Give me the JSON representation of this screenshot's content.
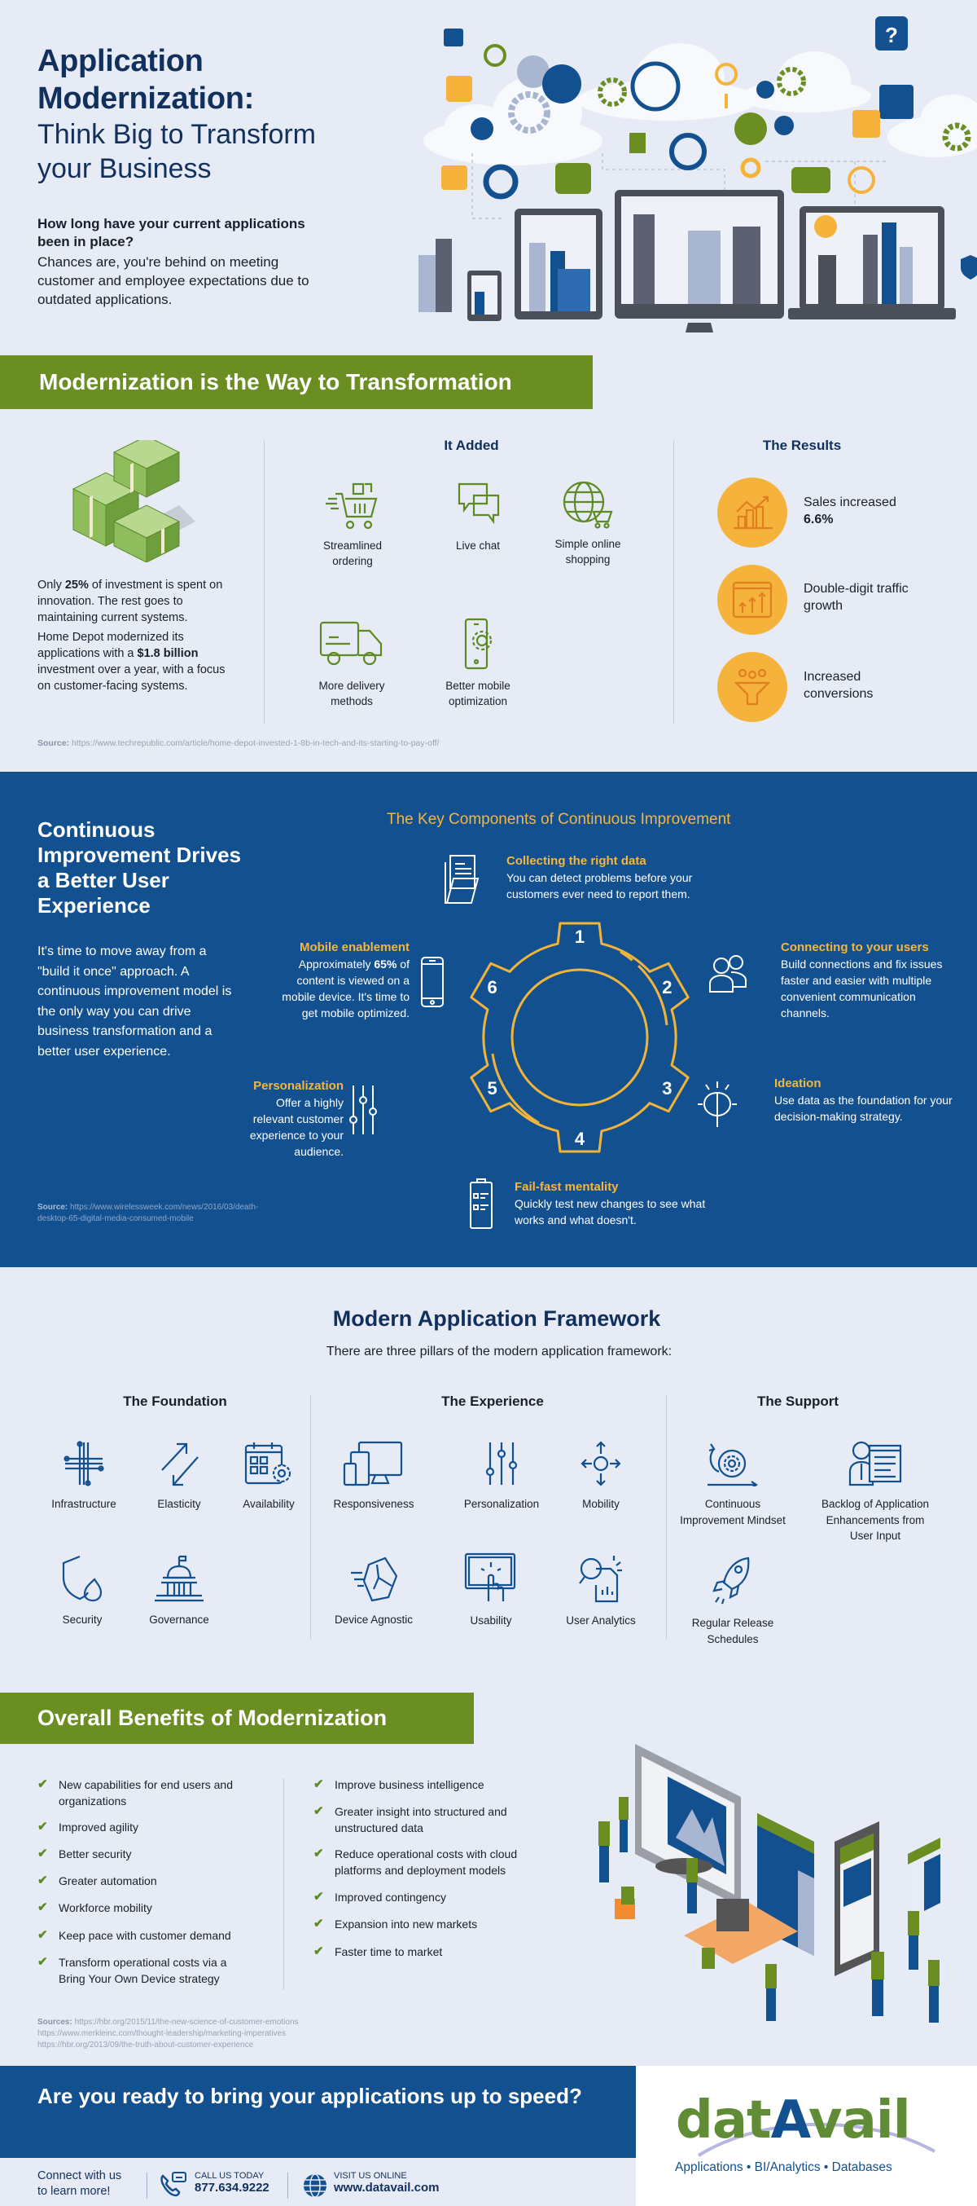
{
  "hero": {
    "title_bold": "Application Modernization:",
    "title_line1": "Application",
    "title_line2": "Modernization:",
    "subtitle_line1": "Think Big to Transform",
    "subtitle_line2": "your Business",
    "question": "How long have your current applications been in place?",
    "body": "Chances are, you're behind on meeting customer and employee expectations due to outdated applications."
  },
  "section1": {
    "banner": "Modernization is the Way to Transformation",
    "stat1_pre": "Only ",
    "stat1_bold": "25%",
    "stat1_post": " of investment is spent on innovation. The rest goes to maintaining current systems.",
    "stat2_pre": "Home Depot modernized its applications with a ",
    "stat2_bold": "$1.8 billion",
    "stat2_post": " investment over a year, with a focus on customer-facing systems.",
    "added_heading": "It Added",
    "added_items": [
      {
        "label": "Streamlined ordering",
        "icon": "shopping-cart-icon"
      },
      {
        "label": "Live chat",
        "icon": "chat-bubbles-icon"
      },
      {
        "label": "Simple online shopping",
        "icon": "globe-cart-icon"
      },
      {
        "label": "More delivery methods",
        "icon": "delivery-truck-icon"
      },
      {
        "label": "Better mobile optimization",
        "icon": "mobile-gear-icon"
      }
    ],
    "results_heading": "The Results",
    "results": [
      {
        "text": "Sales increased",
        "bold": "6.6%",
        "icon": "growth-chart-icon"
      },
      {
        "text": "Double-digit traffic growth",
        "bold": "",
        "icon": "traffic-arrows-icon"
      },
      {
        "text": "Increased conversions",
        "bold": "",
        "icon": "funnel-icon"
      }
    ],
    "source_label": "Source:",
    "source_url": "https://www.techrepublic.com/article/home-depot-invested-1-8b-in-tech-and-its-starting-to-pay-off/"
  },
  "continuous": {
    "title": "Continuous Improvement Drives a Better User Experience",
    "body": "It's time to move away from a \"build it once\" approach. A continuous improvement model is the only way you can drive business transformation and a better user experience.",
    "source_label": "Source:",
    "source_url": "https://www.wirelessweek.com/news/2016/03/death-desktop-65-digital-media-consumed-mobile",
    "components_title": "The Key Components of Continuous Improvement",
    "gear_numbers": [
      "1",
      "2",
      "3",
      "4",
      "5",
      "6"
    ],
    "components": [
      {
        "number": "1",
        "title": "Collecting the right data",
        "body": "You can detect problems before your customers ever need to report them.",
        "icon": "folder-documents-icon"
      },
      {
        "number": "2",
        "title": "Connecting to your users",
        "body": "Build connections and fix issues faster and easier with multiple convenient communication channels.",
        "icon": "users-icon"
      },
      {
        "number": "3",
        "title": "Ideation",
        "body": "Use data as the foundation for your decision-making strategy.",
        "icon": "brain-idea-icon"
      },
      {
        "number": "4",
        "title": "Fail-fast mentality",
        "body": "Quickly test new changes to see what works and what doesn't.",
        "icon": "clipboard-checklist-icon"
      },
      {
        "number": "5",
        "title": "Personalization",
        "body": "Offer a highly relevant customer experience to your audience.",
        "icon": "sliders-icon"
      },
      {
        "number": "6",
        "title": "Mobile enablement",
        "body_pre": "Approximately ",
        "body_bold": "65%",
        "body_post": " of content is viewed on a mobile device. It's time to get mobile optimized.",
        "icon": "smartphone-icon"
      }
    ]
  },
  "framework": {
    "title": "Modern Application Framework",
    "subtitle": "There are three pillars of the modern application framework:",
    "pillars": [
      {
        "heading": "The Foundation",
        "items": [
          {
            "label": "Infrastructure",
            "icon": "circuit-icon"
          },
          {
            "label": "Elasticity",
            "icon": "elastic-arrows-icon"
          },
          {
            "label": "Availability",
            "icon": "calendar-gear-icon"
          },
          {
            "label": "Security",
            "icon": "shield-fire-icon"
          },
          {
            "label": "Governance",
            "icon": "capitol-building-icon"
          }
        ]
      },
      {
        "heading": "The Experience",
        "items": [
          {
            "label": "Responsiveness",
            "icon": "multi-device-icon"
          },
          {
            "label": "Personalization",
            "icon": "sliders-icon"
          },
          {
            "label": "Mobility",
            "icon": "move-arrows-icon"
          },
          {
            "label": "Device Agnostic",
            "icon": "cube-motion-icon"
          },
          {
            "label": "Usability",
            "icon": "touch-screen-icon"
          },
          {
            "label": "User Analytics",
            "icon": "magnifier-report-icon"
          }
        ]
      },
      {
        "heading": "The Support",
        "items": [
          {
            "label": "Continuous Improvement Mindset",
            "icon": "cycle-gear-icon"
          },
          {
            "label": "Backlog of Application Enhancements from User Input",
            "icon": "person-screen-icon"
          },
          {
            "label": "Regular Release Schedules",
            "icon": "rocket-icon"
          }
        ]
      }
    ]
  },
  "benefits": {
    "banner": "Overall Benefits of Modernization",
    "left": [
      "New capabilities for end users and organizations",
      "Improved agility",
      "Better security",
      "Greater automation",
      "Workforce mobility",
      "Keep pace with customer demand",
      "Transform operational costs via a Bring Your Own Device strategy"
    ],
    "right": [
      "Improve business intelligence",
      "Greater insight into structured and unstructured data",
      "Reduce operational costs with cloud platforms and deployment models",
      "Improved contingency",
      "Expansion into new markets",
      "Faster time to market"
    ],
    "sources_label": "Sources:",
    "sources": [
      "https://hbr.org/2015/11/the-new-science-of-customer-emotions",
      "https://www.merkleinc.com/thought-leadership/marketing-imperatives",
      "https://hbr.org/2013/09/the-truth-about-customer-experience"
    ]
  },
  "cta": {
    "headline": "Are you ready to bring your applications up to speed?",
    "connect": "Connect with us to learn more!",
    "connect_line1": "Connect with us",
    "connect_line2": "to learn more!",
    "call_label": "CALL US TODAY",
    "phone": "877.634.9222",
    "visit_label": "VISIT US ONLINE",
    "website": "www.datavail.com"
  },
  "brand": {
    "logo_part1": "dat",
    "logo_part2": "A",
    "logo_part3": "vail",
    "tagline": "Applications • BI/Analytics • Databases",
    "colors": {
      "green": "#6b8e23",
      "blue": "#13508f",
      "navy": "#12305c",
      "gold": "#f4b63e",
      "orange": "#f6b33c",
      "background": "#e6ebf5"
    }
  }
}
